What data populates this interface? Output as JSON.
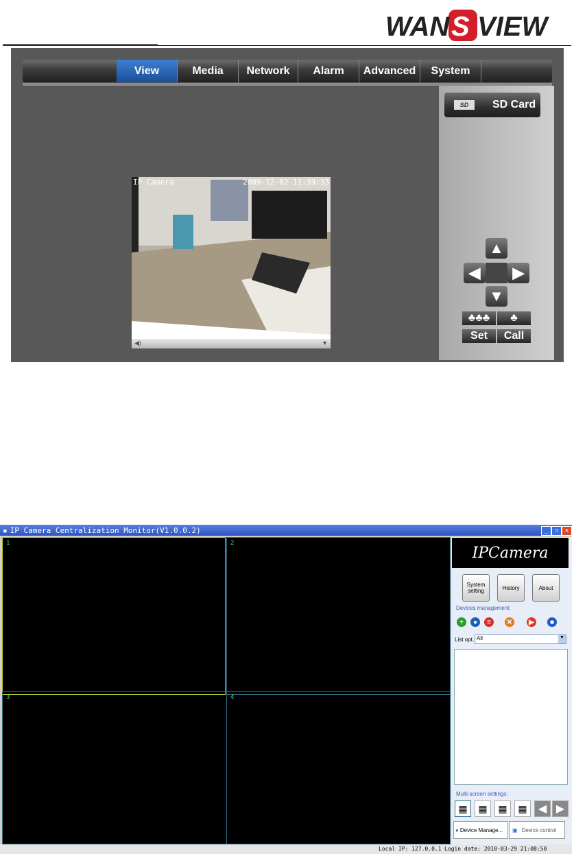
{
  "brand": {
    "logo_text": "WANSVIEW"
  },
  "web": {
    "tabs": [
      "View",
      "Media",
      "Network",
      "Alarm",
      "Advanced",
      "System"
    ],
    "active_tab": "View",
    "sd_card_label": "SD Card",
    "camera_label": "IP Camera",
    "timestamp": "2009-12-02 11:39:33",
    "ptz": {
      "up": "^",
      "left": "<",
      "right": ">",
      "down": "v"
    },
    "set_label": "Set",
    "call_label": "Call"
  },
  "app": {
    "title": "IP Camera Centralization Monitor(V1.0.0.2)",
    "brand": "IPCamera",
    "cells": [
      "1",
      "2",
      "3",
      "4"
    ],
    "buttons": {
      "system_setting": "System setting",
      "history": "History",
      "about": "About"
    },
    "devices_management": "Devices management:",
    "list_opt_label": "List opt.",
    "list_opt_value": "All",
    "multi_screen_settings": "Multi-screen settings:",
    "bottom_tabs": {
      "device_manage": "Device Manage...",
      "device_control": "Device control"
    },
    "status": {
      "local_ip": "Local IP: 127.0.0.1",
      "login_date": "Login date: 2010-03-29 21:08:50"
    }
  }
}
